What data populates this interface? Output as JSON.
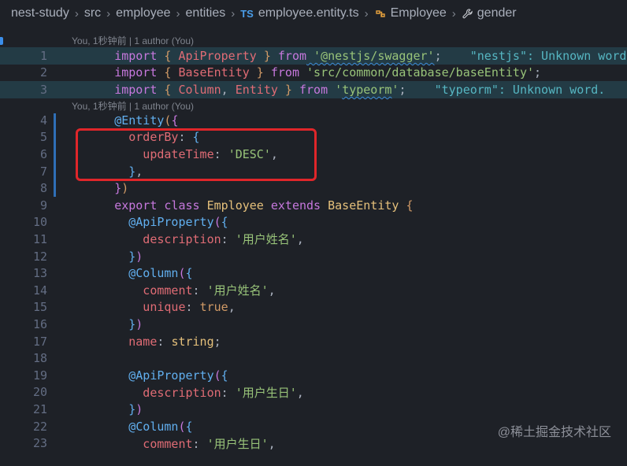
{
  "breadcrumb": {
    "items": [
      "nest-study",
      "src",
      "employee",
      "entities"
    ],
    "file_lang": "TS",
    "file": "employee.entity.ts",
    "symbol": "Employee",
    "property": "gender"
  },
  "blame": {
    "top": "You, 1秒钟前 | 1 author (You)",
    "mid": "You, 1秒钟前 | 1 author (You)"
  },
  "lines": {
    "n1": "1",
    "n2": "2",
    "n3": "3",
    "n4": "4",
    "n5": "5",
    "n6": "6",
    "n7": "7",
    "n8": "8",
    "n9": "9",
    "n10": "10",
    "n11": "11",
    "n12": "12",
    "n13": "13",
    "n14": "14",
    "n15": "15",
    "n16": "16",
    "n17": "17",
    "n18": "18",
    "n19": "19",
    "n20": "20",
    "n21": "21",
    "n22": "22",
    "n23": "23"
  },
  "code": {
    "l1_kw": "import",
    "l1_open": " { ",
    "l1_id": "ApiProperty",
    "l1_close": " } ",
    "l1_from": "from",
    "l1_str": " '@nestjs/swagger'",
    "l1_semi": ";",
    "l1_warn": "    \"nestjs\": Unknown word.",
    "l2_kw": "import",
    "l2_open": " { ",
    "l2_id": "BaseEntity",
    "l2_close": " } ",
    "l2_from": "from",
    "l2_str": " 'src/common/database/baseEntity'",
    "l2_semi": ";",
    "l3_kw": "import",
    "l3_open": " { ",
    "l3_id1": "Column",
    "l3_comma": ", ",
    "l3_id2": "Entity",
    "l3_close": " } ",
    "l3_from": "from",
    "l3_str_q1": " '",
    "l3_str": "typeorm",
    "l3_str_q2": "'",
    "l3_semi": ";",
    "l3_warn": "    \"typeorm\": Unknown word.",
    "l4_dec": "@Entity",
    "l4_paren": "(",
    "l4_brace": "{",
    "l5_prop": "  orderBy",
    "l5_colon": ": ",
    "l5_brace": "{",
    "l6_prop": "    updateTime",
    "l6_colon": ": ",
    "l6_str": "'DESC'",
    "l6_comma": ",",
    "l7_brace": "  }",
    "l7_comma": ",",
    "l8_brace": "}",
    "l8_paren": ")",
    "l9_export": "export",
    "l9_class": " class ",
    "l9_name": "Employee",
    "l9_ext": " extends ",
    "l9_base": "BaseEntity",
    "l9_open": " {",
    "l10_dec": "  @ApiProperty",
    "l10_paren": "(",
    "l10_brace": "{",
    "l11_prop": "    description",
    "l11_colon": ": ",
    "l11_str": "'用户姓名'",
    "l11_comma": ",",
    "l12_brace": "  }",
    "l12_paren": ")",
    "l13_dec": "  @Column",
    "l13_paren": "(",
    "l13_brace": "{",
    "l14_prop": "    comment",
    "l14_colon": ": ",
    "l14_str": "'用户姓名'",
    "l14_comma": ",",
    "l15_prop": "    unique",
    "l15_colon": ": ",
    "l15_val": "true",
    "l15_comma": ",",
    "l16_brace": "  }",
    "l16_paren": ")",
    "l17_prop": "  name",
    "l17_colon": ": ",
    "l17_type": "string",
    "l17_semi": ";",
    "l19_dec": "  @ApiProperty",
    "l19_paren": "(",
    "l19_brace": "{",
    "l20_prop": "    description",
    "l20_colon": ": ",
    "l20_str": "'用户生日'",
    "l20_comma": ",",
    "l21_brace": "  }",
    "l21_paren": ")",
    "l22_dec": "  @Column",
    "l22_paren": "(",
    "l22_brace": "{",
    "l23_prop": "    comment",
    "l23_colon": ": ",
    "l23_str": "'用户生日'",
    "l23_comma": ","
  },
  "watermark": "@稀土掘金技术社区",
  "colors": {
    "background": "#1e2127",
    "keyword": "#c678dd",
    "string": "#98c379",
    "class": "#e5c07b",
    "function": "#61afef",
    "property": "#e06c75",
    "highlight_box": "#e0262a"
  }
}
